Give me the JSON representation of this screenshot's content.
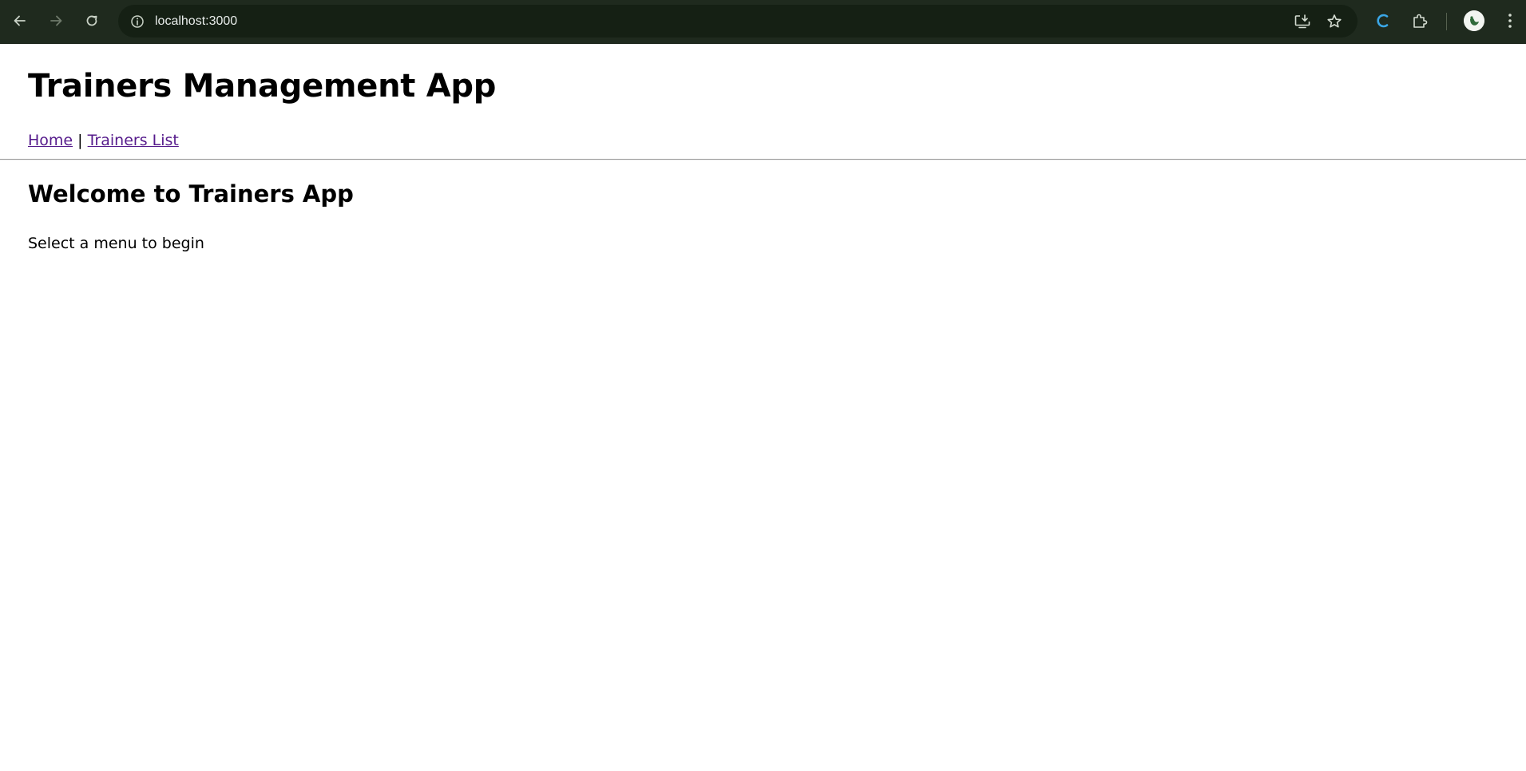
{
  "browser": {
    "url": "localhost:3000",
    "toolbar_color": "#1f2a1e",
    "omnibox_color": "#152014",
    "icons": {
      "back": "arrow-left-icon",
      "forward": "arrow-right-icon",
      "reload": "reload-icon",
      "site_info": "info-icon",
      "install": "install-app-icon",
      "bookmark": "star-icon",
      "extension_loader": "loading-arc-icon",
      "extensions": "puzzle-icon",
      "profile": "avatar",
      "menu": "kebab-menu-icon"
    }
  },
  "page": {
    "title": "Trainers Management App",
    "nav": {
      "home_label": "Home",
      "separator": "|",
      "trainers_label": "Trainers List"
    },
    "welcome": {
      "heading": "Welcome to Trainers App",
      "text": "Select a menu to begin"
    },
    "link_color": "#551a8b"
  }
}
